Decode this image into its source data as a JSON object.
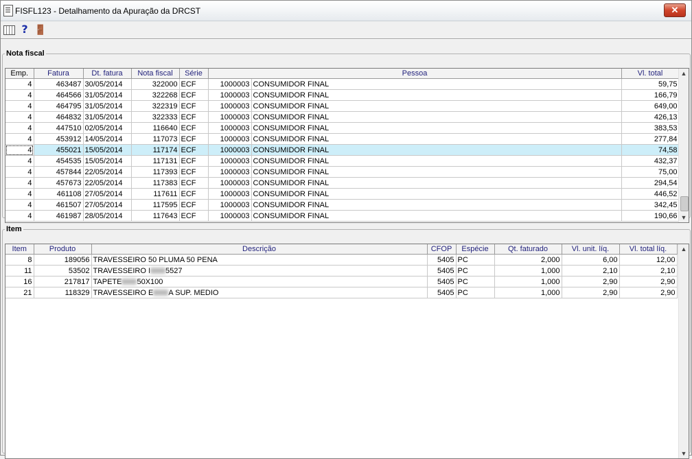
{
  "window": {
    "title": "FISFL123 - Detalhamento da Apuração da DRCST",
    "close_label": "✕"
  },
  "toolbar": {
    "help_glyph": "?",
    "exit_glyph": "🚪"
  },
  "nota_fiscal": {
    "legend": "Nota fiscal",
    "columns": [
      "Emp.",
      "Fatura",
      "Dt. fatura",
      "Nota fiscal",
      "Série",
      "Pessoa",
      "Vl. total"
    ],
    "selected_index": 6,
    "rows": [
      [
        "4",
        "463487",
        "30/05/2014",
        "322000",
        "ECF",
        "1000003",
        "CONSUMIDOR FINAL",
        "59,75"
      ],
      [
        "4",
        "464566",
        "31/05/2014",
        "322268",
        "ECF",
        "1000003",
        "CONSUMIDOR FINAL",
        "166,79"
      ],
      [
        "4",
        "464795",
        "31/05/2014",
        "322319",
        "ECF",
        "1000003",
        "CONSUMIDOR FINAL",
        "649,00"
      ],
      [
        "4",
        "464832",
        "31/05/2014",
        "322333",
        "ECF",
        "1000003",
        "CONSUMIDOR FINAL",
        "426,13"
      ],
      [
        "4",
        "447510",
        "02/05/2014",
        "116640",
        "ECF",
        "1000003",
        "CONSUMIDOR FINAL",
        "383,53"
      ],
      [
        "4",
        "453912",
        "14/05/2014",
        "117073",
        "ECF",
        "1000003",
        "CONSUMIDOR FINAL",
        "277,84"
      ],
      [
        "4",
        "455021",
        "15/05/2014",
        "117174",
        "ECF",
        "1000003",
        "CONSUMIDOR FINAL",
        "74,58"
      ],
      [
        "4",
        "454535",
        "15/05/2014",
        "117131",
        "ECF",
        "1000003",
        "CONSUMIDOR FINAL",
        "432,37"
      ],
      [
        "4",
        "457844",
        "22/05/2014",
        "117393",
        "ECF",
        "1000003",
        "CONSUMIDOR FINAL",
        "75,00"
      ],
      [
        "4",
        "457673",
        "22/05/2014",
        "117383",
        "ECF",
        "1000003",
        "CONSUMIDOR FINAL",
        "294,54"
      ],
      [
        "4",
        "461108",
        "27/05/2014",
        "117611",
        "ECF",
        "1000003",
        "CONSUMIDOR FINAL",
        "446,52"
      ],
      [
        "4",
        "461507",
        "27/05/2014",
        "117595",
        "ECF",
        "1000003",
        "CONSUMIDOR FINAL",
        "342,45"
      ],
      [
        "4",
        "461987",
        "28/05/2014",
        "117643",
        "ECF",
        "1000003",
        "CONSUMIDOR FINAL",
        "190,66"
      ]
    ]
  },
  "item": {
    "legend": "Item",
    "columns": [
      "Item",
      "Produto",
      "Descrição",
      "CFOP",
      "Espécie",
      "Qt. faturado",
      "Vl. unit. líq.",
      "Vl. total líq."
    ],
    "rows": [
      {
        "item": "8",
        "produto": "189056",
        "desc_a": "TRAVESSEIRO 50 PLUMA 50 PENA",
        "desc_b": "",
        "blurred": false,
        "cfop": "5405",
        "especie": "PC",
        "qt": "2,000",
        "unit": "6,00",
        "total": "12,00"
      },
      {
        "item": "11",
        "produto": "53502",
        "desc_a": "TRAVESSEIRO I",
        "desc_b": "5527",
        "blurred": true,
        "cfop": "5405",
        "especie": "PC",
        "qt": "1,000",
        "unit": "2,10",
        "total": "2,10"
      },
      {
        "item": "16",
        "produto": "217817",
        "desc_a": "TAPETE",
        "desc_b": "50X100",
        "blurred": true,
        "cfop": "5405",
        "especie": "PC",
        "qt": "1,000",
        "unit": "2,90",
        "total": "2,90"
      },
      {
        "item": "21",
        "produto": "118329",
        "desc_a": "TRAVESSEIRO E",
        "desc_b": "A SUP. MEDIO",
        "blurred": true,
        "cfop": "5405",
        "especie": "PC",
        "qt": "1,000",
        "unit": "2,90",
        "total": "2,90"
      }
    ]
  }
}
